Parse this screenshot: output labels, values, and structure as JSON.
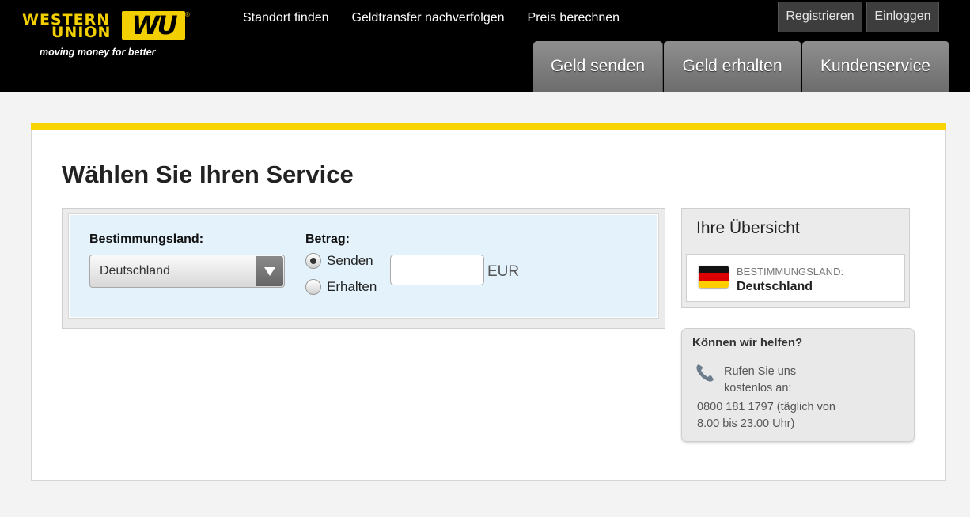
{
  "header": {
    "logo": {
      "line1": "WESTERN",
      "line2": "UNION",
      "mark": "WU",
      "tm": "®"
    },
    "tagline": "moving money for better",
    "topnav": [
      "Standort finden",
      "Geldtransfer nachverfolgen",
      "Preis berechnen"
    ],
    "account": {
      "register": "Registrieren",
      "login": "Einloggen"
    },
    "tabs": [
      "Geld senden",
      "Geld erhalten",
      "Kundenservice"
    ]
  },
  "colors": {
    "brand_yellow": "#f8d400",
    "header_bg": "#000000",
    "form_bg": "#e3f2fb"
  },
  "main": {
    "title": "Wählen Sie Ihren Service",
    "form": {
      "country_label": "Bestimmungsland:",
      "country_value": "Deutschland",
      "amount_label": "Betrag:",
      "radio_send": "Senden",
      "radio_receive": "Erhalten",
      "selected_radio": "Senden",
      "amount_value": "",
      "currency": "EUR"
    }
  },
  "summary": {
    "title": "Ihre Übersicht",
    "label": "BESTIMMUNGSLAND:",
    "value": "Deutschland",
    "flag_icon": "germany-flag-icon"
  },
  "help": {
    "title": "Können wir helfen?",
    "line1": "Rufen Sie uns kostenlos an:",
    "line2": "0800 181 1797 (täglich von 8.00 bis 23.00 Uhr)",
    "icon": "phone-icon"
  }
}
